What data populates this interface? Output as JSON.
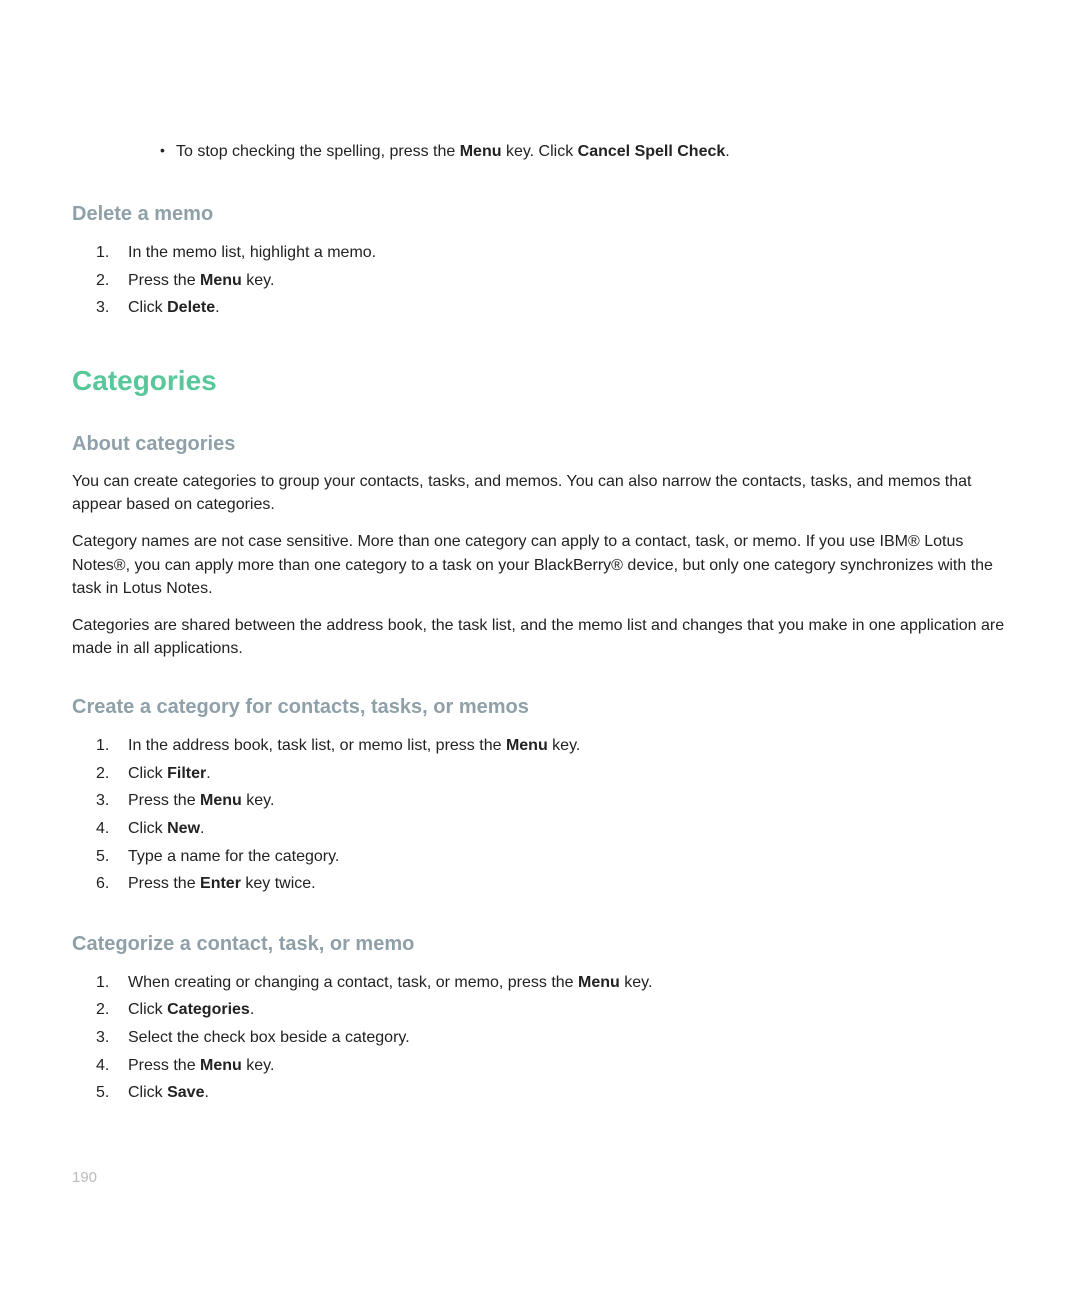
{
  "bullet": {
    "pre": "To stop checking the spelling, press the ",
    "b1": "Menu",
    "mid": " key. Click ",
    "b2": "Cancel Spell Check",
    "post": "."
  },
  "s1": {
    "title": "Delete a memo",
    "items": [
      {
        "t1": "In the memo list, highlight a memo."
      },
      {
        "t1": "Press the ",
        "b1": "Menu",
        "t2": " key."
      },
      {
        "t1": "Click ",
        "b1": "Delete",
        "t2": "."
      }
    ]
  },
  "h2": "Categories",
  "s2": {
    "title": "About categories",
    "p1": "You can create categories to group your contacts, tasks, and memos. You can also narrow the contacts, tasks, and memos that appear based on categories.",
    "p2": "Category names are not case sensitive. More than one category can apply to a contact, task, or memo. If you use IBM® Lotus Notes®, you can apply more than one category to a task on your BlackBerry® device, but only one category synchronizes with the task in Lotus Notes.",
    "p3": "Categories are shared between the address book, the task list, and the memo list and changes that you make in one application are made in all applications."
  },
  "s3": {
    "title": "Create a category for contacts, tasks, or memos",
    "items": [
      {
        "t1": "In the address book, task list, or memo list, press the ",
        "b1": "Menu",
        "t2": " key."
      },
      {
        "t1": "Click ",
        "b1": "Filter",
        "t2": "."
      },
      {
        "t1": "Press the ",
        "b1": "Menu",
        "t2": " key."
      },
      {
        "t1": "Click ",
        "b1": "New",
        "t2": "."
      },
      {
        "t1": "Type a name for the category."
      },
      {
        "t1": "Press the ",
        "b1": "Enter",
        "t2": " key twice."
      }
    ]
  },
  "s4": {
    "title": "Categorize a contact, task, or memo",
    "items": [
      {
        "t1": "When creating or changing a contact, task, or memo, press the ",
        "b1": "Menu",
        "t2": " key."
      },
      {
        "t1": "Click ",
        "b1": "Categories",
        "t2": "."
      },
      {
        "t1": "Select the check box beside a category."
      },
      {
        "t1": "Press the ",
        "b1": "Menu",
        "t2": " key."
      },
      {
        "t1": "Click ",
        "b1": "Save",
        "t2": "."
      }
    ]
  },
  "page": "190"
}
